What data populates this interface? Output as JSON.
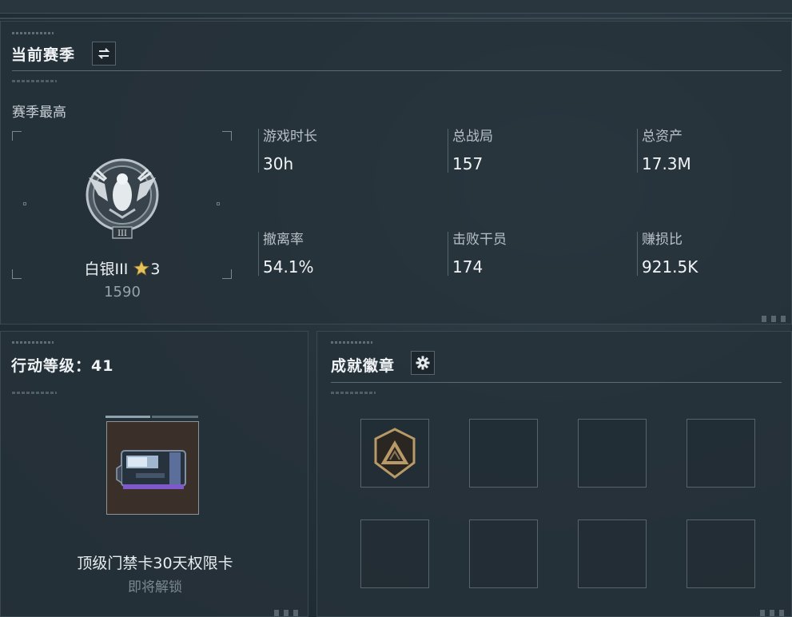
{
  "season": {
    "title": "当前赛季",
    "swap_icon": "swap-arrows-icon",
    "subtitle": "赛季最高",
    "rank": {
      "name": "白银III",
      "star_icon": "gold-star-icon",
      "stars": "3",
      "points": "1590",
      "emblem_icon": "silver-eagle-rank-emblem",
      "emblem_numeral": "III"
    },
    "stats": [
      {
        "label": "游戏时长",
        "value": "30h"
      },
      {
        "label": "总战局",
        "value": "157"
      },
      {
        "label": "总资产",
        "value": "17.3M"
      },
      {
        "label": "撤离率",
        "value": "54.1%"
      },
      {
        "label": "击败干员",
        "value": "174"
      },
      {
        "label": "赚损比",
        "value": "921.5K"
      }
    ]
  },
  "action": {
    "title": "行动等级：41",
    "item_icon": "access-card-icon",
    "item_name": "顶级门禁卡30天权限卡",
    "item_status": "即将解锁"
  },
  "badges": {
    "title": "成就徽章",
    "settings_icon": "gear-icon",
    "slot1_icon": "mountain-shield-badge-icon"
  },
  "colors": {
    "background": "#25323a",
    "panel_border": "#3b4953",
    "text_primary": "#f0f3f5",
    "text_muted": "#7c8891",
    "star": "#e6c35a",
    "badge_gold": "#b79a67"
  }
}
